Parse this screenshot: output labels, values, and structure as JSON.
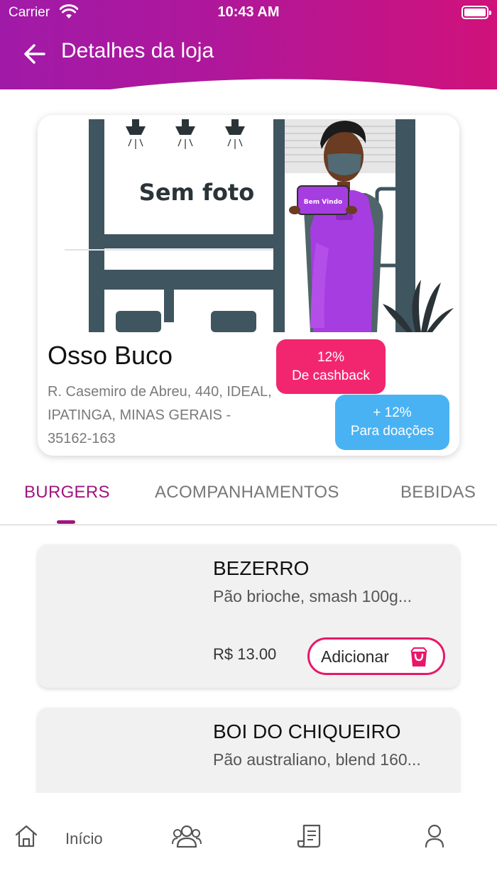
{
  "status_bar": {
    "carrier": "Carrier",
    "time": "10:43 AM"
  },
  "header": {
    "title": "Detalhes da loja",
    "back_icon": "arrow-left-icon"
  },
  "store": {
    "illustration_text": "Sem foto",
    "sign_text": "Bem Vindo",
    "name": "Osso Buco",
    "address": "R. Casemiro de Abreu, 440, IDEAL, IPATINGA, MINAS GERAIS - 35162-163",
    "cashback": {
      "percent": "12%",
      "label": "De cashback",
      "color": "#f2266f"
    },
    "donation": {
      "percent": "+ 12%",
      "label": "Para doações",
      "color": "#49b2f3"
    }
  },
  "tabs": [
    {
      "label": "BURGERS",
      "active": true
    },
    {
      "label": "ACOMPANHAMENTOS",
      "active": false
    },
    {
      "label": "BEBIDAS",
      "active": false
    }
  ],
  "products": [
    {
      "name": "BEZERRO",
      "description": "Pão brioche, smash 100g...",
      "price": "R$ 13.00",
      "button": "Adicionar"
    },
    {
      "name": "BOI DO CHIQUEIRO",
      "description": "Pão australiano, blend 160...",
      "price": "",
      "button": ""
    }
  ],
  "bottom_nav": [
    {
      "icon": "home-icon",
      "label": "Início"
    },
    {
      "icon": "users-icon",
      "label": ""
    },
    {
      "icon": "receipt-icon",
      "label": ""
    },
    {
      "icon": "profile-icon",
      "label": ""
    }
  ],
  "colors": {
    "brand": "#a0157e",
    "accent": "#e8176a"
  }
}
